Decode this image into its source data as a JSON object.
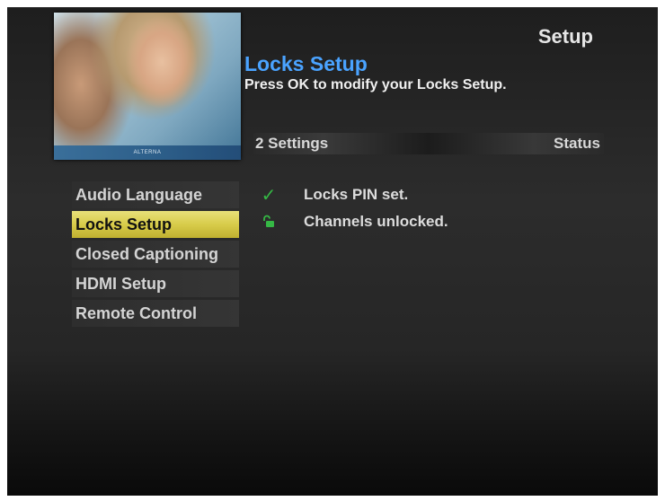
{
  "header": {
    "title": "Setup",
    "section_title": "Locks Setup",
    "instructions": "Press OK to modify your Locks Setup."
  },
  "thumbnail": {
    "band_text": "ALTERNA"
  },
  "settings_bar": {
    "count_label": "2 Settings",
    "status_label": "Status"
  },
  "menu": {
    "selected_index": 1,
    "items": [
      {
        "label": "Audio Language"
      },
      {
        "label": "Locks Setup"
      },
      {
        "label": "Closed Captioning"
      },
      {
        "label": "HDMI Setup"
      },
      {
        "label": "Remote Control"
      }
    ]
  },
  "status": {
    "items": [
      {
        "icon": "check-icon",
        "text": "Locks PIN set."
      },
      {
        "icon": "unlocked-padlock-icon",
        "text": "Channels unlocked."
      }
    ]
  },
  "colors": {
    "accent_blue": "#4aa3ff",
    "selection_yellow": "#d8cc4a",
    "status_green": "#35b845"
  }
}
